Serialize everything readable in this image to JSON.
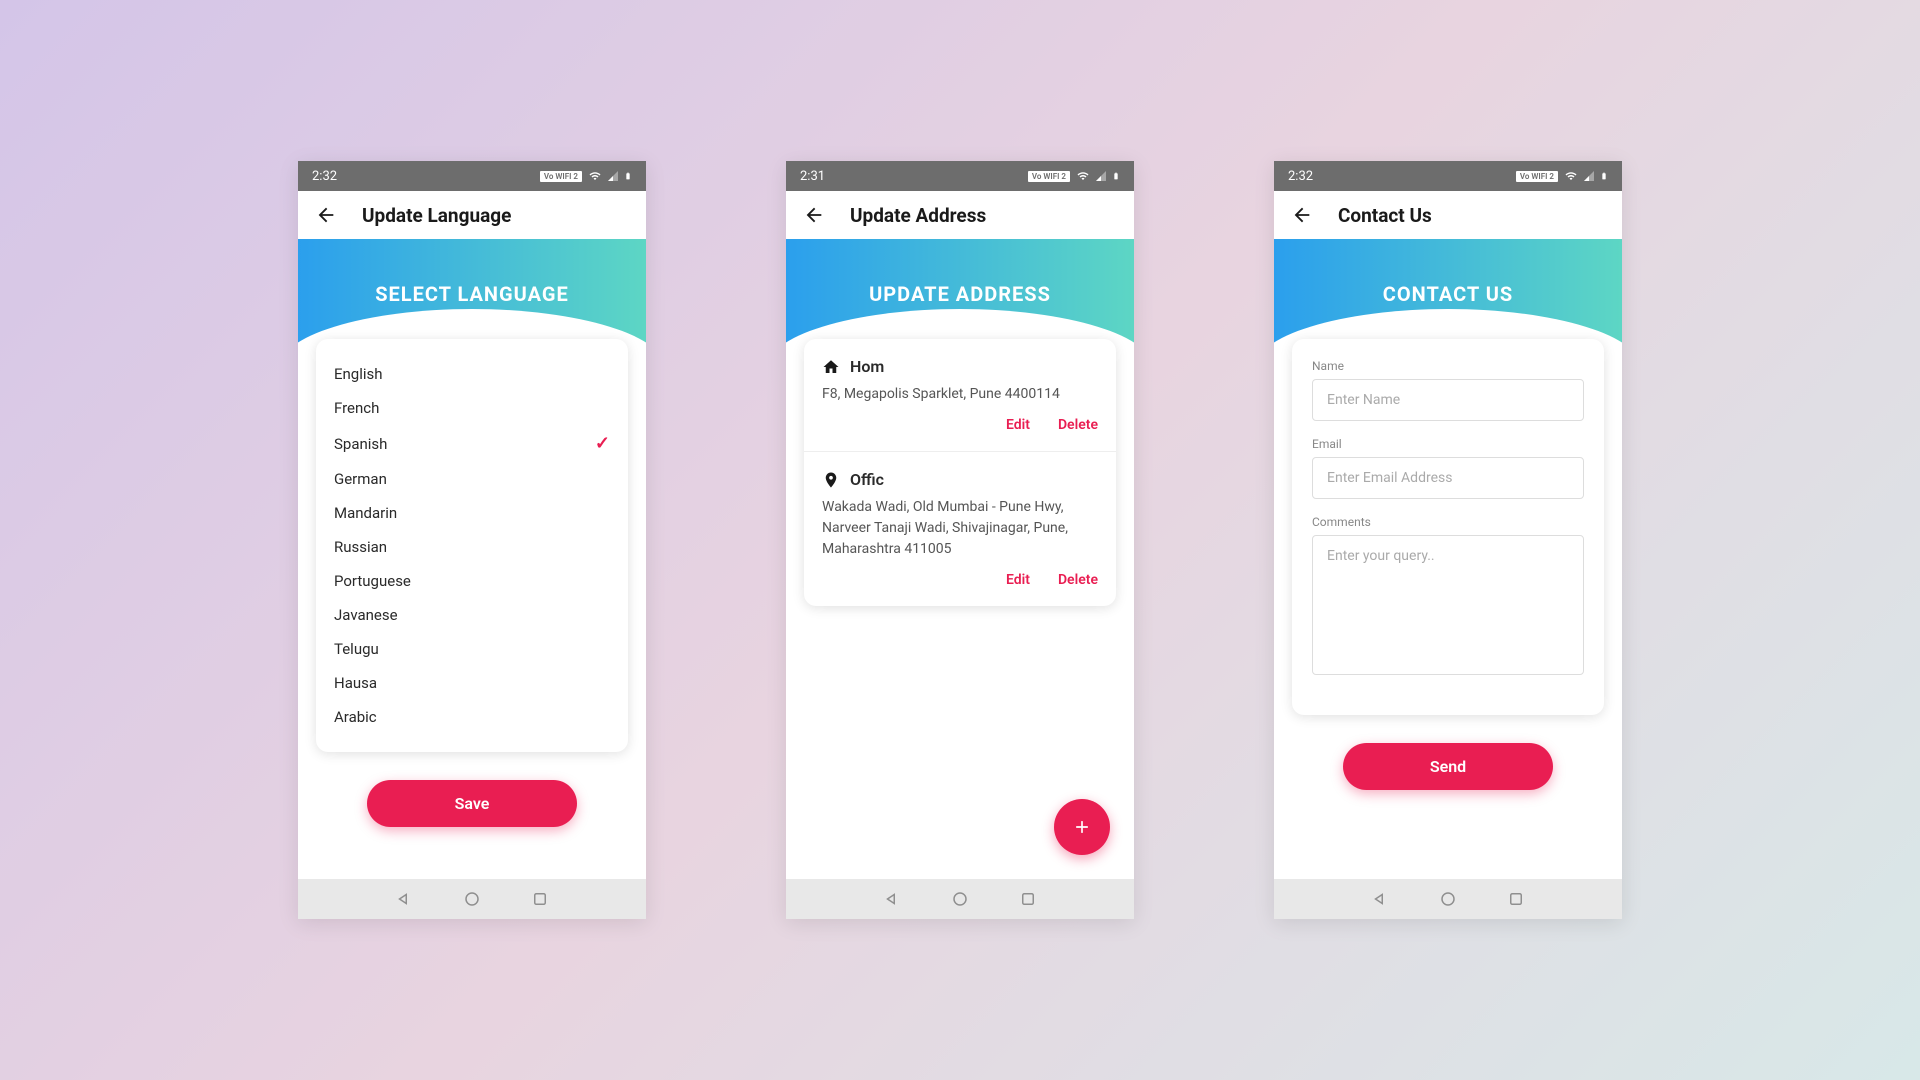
{
  "screens": [
    {
      "status_time": "2:32",
      "wifi_label": "Vo WIFI 2",
      "app_title": "Update Language",
      "header_title": "SELECT LANGUAGE",
      "languages": [
        "English",
        "French",
        "Spanish",
        "German",
        "Mandarin",
        "Russian",
        "Portuguese",
        "Javanese",
        "Telugu",
        "Hausa",
        "Arabic"
      ],
      "selected_index": 2,
      "save_label": "Save"
    },
    {
      "status_time": "2:31",
      "wifi_label": "Vo WIFI 2",
      "app_title": "Update Address",
      "header_title": "UPDATE ADDRESS",
      "addresses": [
        {
          "label": "Hom",
          "icon": "home",
          "text": "F8, Megapolis Sparklet, Pune 4400114",
          "edit": "Edit",
          "delete": "Delete"
        },
        {
          "label": "Offic",
          "icon": "location",
          "text": "Wakada Wadi, Old Mumbai - Pune Hwy, Narveer Tanaji Wadi, Shivajinagar, Pune, Maharashtra 411005",
          "edit": "Edit",
          "delete": "Delete"
        }
      ],
      "fab_label": "+"
    },
    {
      "status_time": "2:32",
      "wifi_label": "Vo WIFI 2",
      "app_title": "Contact Us",
      "header_title": "CONTACT US",
      "form": {
        "name_label": "Name",
        "name_placeholder": "Enter Name",
        "email_label": "Email",
        "email_placeholder": "Enter Email Address",
        "comments_label": "Comments",
        "comments_placeholder": "Enter your query..",
        "send_label": "Send"
      }
    }
  ]
}
